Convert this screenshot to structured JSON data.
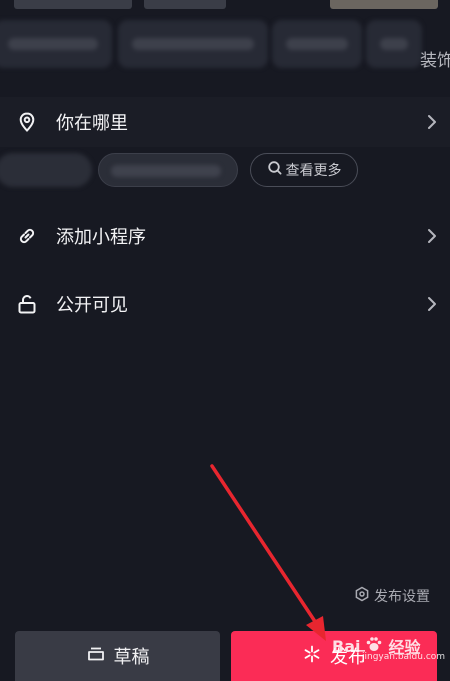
{
  "header": {
    "decoration_label": "装饰"
  },
  "location": {
    "label": "你在哪里",
    "more_chip": "查看更多"
  },
  "mini_program": {
    "label": "添加小程序"
  },
  "visibility": {
    "label": "公开可见"
  },
  "settings": {
    "publish_settings": "发布设置"
  },
  "footer": {
    "draft_label": "草稿",
    "publish_label": "发布"
  },
  "watermark": {
    "brand": "Bai",
    "brand_suffix": "经验",
    "url": "jingyan.baidu.com"
  },
  "colors": {
    "background": "#171922",
    "publish_button": "#fb2c56",
    "draft_button": "#393b45",
    "annotation_arrow": "#e8262f"
  },
  "icons": {
    "location": "location-pin-icon",
    "mini_program": "link-icon",
    "visibility": "unlock-icon",
    "chevron": "chevron-right-icon",
    "search": "search-icon",
    "settings": "hexagon-gear-icon",
    "draft": "tray-icon",
    "publish": "sparkle-icon"
  }
}
